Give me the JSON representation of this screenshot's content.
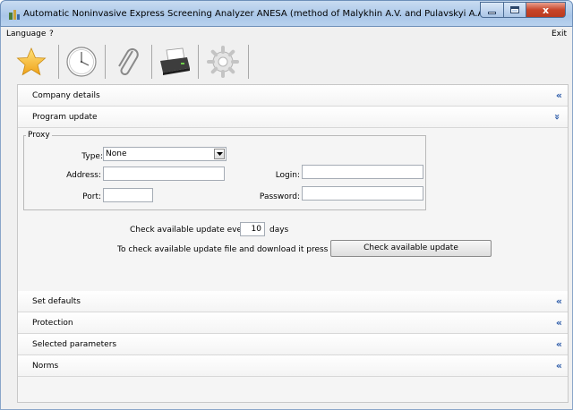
{
  "window": {
    "title": "Automatic Noninvasive Express Screening Analyzer ANESA (method of Malykhin A.V. and Pulavskyi A.A.)",
    "close_glyph": "x"
  },
  "menu": {
    "language_label": "Language",
    "help_label": "?",
    "exit_label": "Exit"
  },
  "toolbar": {
    "icons": [
      "star-icon",
      "clock-icon",
      "paperclip-icon",
      "printer-icon",
      "gear-icon"
    ]
  },
  "sections": [
    {
      "label": "Company details",
      "chevron": "«"
    },
    {
      "label": "Program update",
      "chevron": "»"
    },
    {
      "label": "Set defaults",
      "chevron": "«"
    },
    {
      "label": "Protection",
      "chevron": "«"
    },
    {
      "label": "Selected parameters",
      "chevron": "«"
    },
    {
      "label": "Norms",
      "chevron": "«"
    }
  ],
  "proxy": {
    "group_label": "Proxy",
    "type_label": "Type:",
    "type_value": "None",
    "address_label": "Address:",
    "address_value": "",
    "port_label": "Port:",
    "port_value": "",
    "login_label": "Login:",
    "login_value": "",
    "password_label": "Password:",
    "password_value": ""
  },
  "update": {
    "check_every_prefix": "Check available update every",
    "check_every_value": "10",
    "check_every_suffix": "days",
    "instruction": "To check available update file and download it press button:",
    "button_label": "Check available update"
  },
  "colors": {
    "accent": "#2b5aa8",
    "close_button": "#c8452a"
  }
}
